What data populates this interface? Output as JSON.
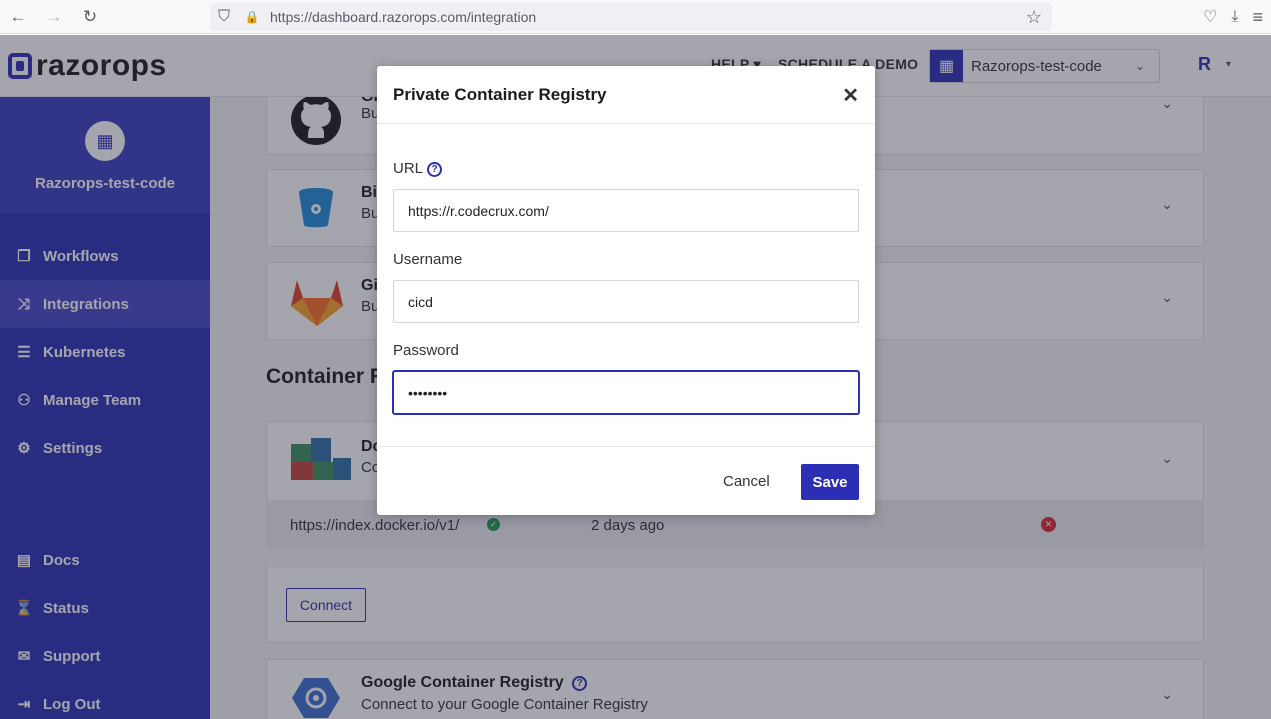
{
  "browser": {
    "url_host": "https://dashboard.razorops.com",
    "url_path": "/integration",
    "back_icon": "←",
    "forward_icon": "→",
    "reload_icon": "↻",
    "shield_icon": "⛉",
    "lock_icon": "🔒",
    "star_icon": "☆",
    "pocket_icon": "♡",
    "download_icon": "⤓",
    "menu_icon": "≡"
  },
  "header": {
    "logo": "razorops",
    "help": "HELP ▾",
    "schedule": "SCHEDULE A DEMO",
    "org_icon": "▦",
    "org_name": "Razorops-test-code",
    "org_caret": "⌄",
    "avatar": "R",
    "avatar_caret": "▾"
  },
  "sidebar": {
    "org_icon": "▦",
    "org_name": "Razorops-test-code",
    "items": [
      {
        "icon": "❐",
        "label": "Workflows"
      },
      {
        "icon": "⤨",
        "label": "Integrations"
      },
      {
        "icon": "☰",
        "label": "Kubernetes"
      },
      {
        "icon": "⚇",
        "label": "Manage Team"
      },
      {
        "icon": "⚙",
        "label": "Settings"
      },
      {
        "icon": "▤",
        "label": "Docs"
      },
      {
        "icon": "⌛",
        "label": "Status"
      },
      {
        "icon": "✉",
        "label": "Support"
      },
      {
        "icon": "⇥",
        "label": "Log Out"
      }
    ]
  },
  "main": {
    "cards": [
      {
        "title": "Gi",
        "sub": "Bu",
        "chevron": "⌄"
      },
      {
        "title": "Bi",
        "sub": "Bu",
        "chevron": "⌄"
      },
      {
        "title": "Gi",
        "sub": "Bu",
        "chevron": "⌄"
      }
    ],
    "container_section": "Container R",
    "docker": {
      "title": "Do",
      "sub": "Co",
      "chevron": "⌄"
    },
    "registry_row": {
      "url": "https://index.docker.io/v1/",
      "check": "✓",
      "time": "2 days ago",
      "remove": "✕"
    },
    "connect": "Connect",
    "gcr": {
      "title": "Google Container Registry",
      "help": "?",
      "sub": "Connect to your Google Container Registry",
      "chevron": "⌄"
    }
  },
  "modal": {
    "title": "Private Container Registry",
    "close": "✕",
    "url_label": "URL",
    "url_help": "?",
    "url_value": "https://r.codecrux.com/",
    "username_label": "Username",
    "username_value": "cicd",
    "password_label": "Password",
    "password_value": "••••••••",
    "cancel": "Cancel",
    "save": "Save"
  },
  "colors": {
    "brand": "#2c2fb5",
    "success": "#1e9e50",
    "danger": "#d9262f"
  }
}
